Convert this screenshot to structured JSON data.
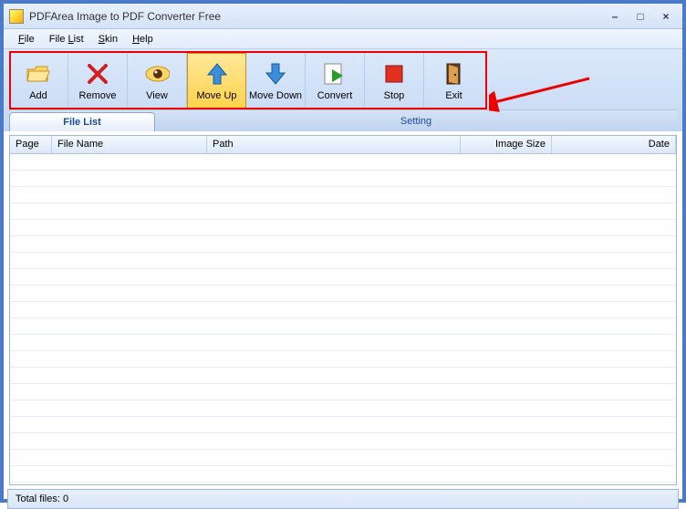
{
  "window": {
    "title": "PDFArea Image to PDF Converter Free"
  },
  "menu": {
    "file": "File",
    "filelist": "File List",
    "skin": "Skin",
    "help": "Help"
  },
  "toolbar": {
    "add": "Add",
    "remove": "Remove",
    "view": "View",
    "moveup": "Move Up",
    "movedown": "Move Down",
    "convert": "Convert",
    "stop": "Stop",
    "exit": "Exit"
  },
  "tabs": {
    "filelist": "File List",
    "setting": "Setting"
  },
  "columns": {
    "page": "Page",
    "filename": "File Name",
    "path": "Path",
    "imagesize": "Image Size",
    "date": "Date"
  },
  "status": {
    "totalfiles": "Total files: 0"
  }
}
